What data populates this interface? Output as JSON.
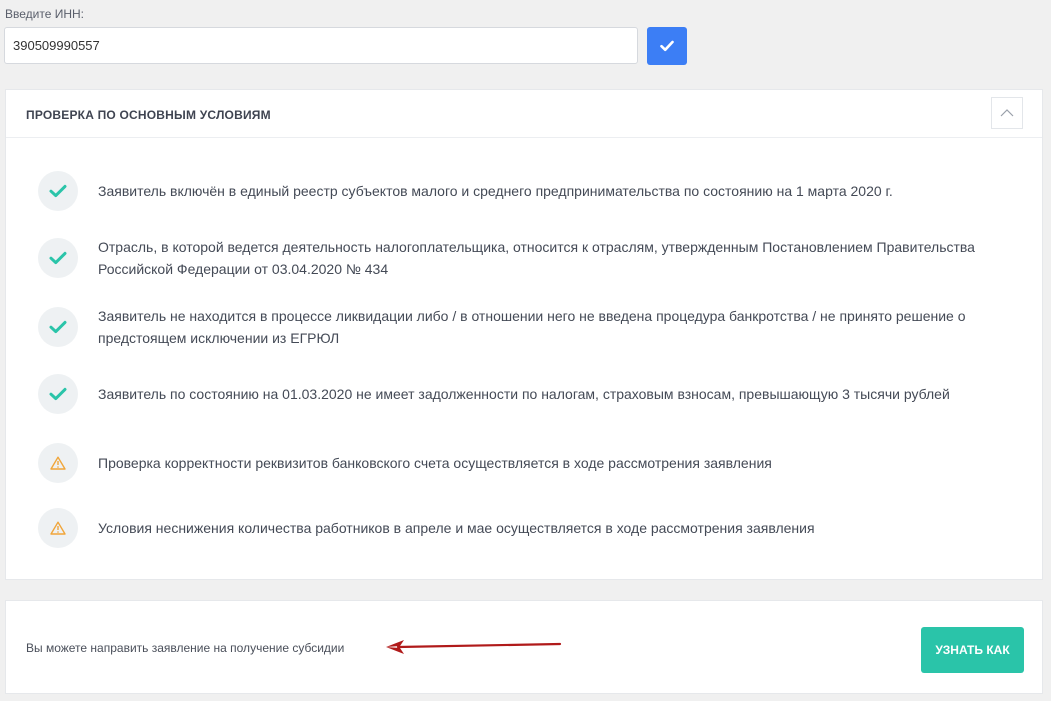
{
  "inn": {
    "label": "Введите ИНН:",
    "value": "390509990557",
    "confirm_icon": "check-icon"
  },
  "check_section": {
    "title": "ПРОВЕРКА ПО ОСНОВНЫМ УСЛОВИЯМ",
    "collapse_icon": "chevron-up-icon",
    "items": [
      {
        "status": "ok",
        "icon": "check-icon",
        "text": "Заявитель включён в единый реестр субъектов малого и среднего предпринимательства по состоянию на 1 марта 2020 г."
      },
      {
        "status": "ok",
        "icon": "check-icon",
        "text": "Отрасль, в которой ведется деятельность налогоплательщика, относится к отраслям, утвержденным Постановлением Правительства Российской Федерации от 03.04.2020 № 434"
      },
      {
        "status": "ok",
        "icon": "check-icon",
        "text": "Заявитель не находится в процессе ликвидации либо / в отношении него не введена процедура банкротства / не принято решение о предстоящем исключении из ЕГРЮЛ"
      },
      {
        "status": "ok",
        "icon": "check-icon",
        "text": "Заявитель по состоянию на 01.03.2020 не имеет задолженности по налогам, страховым взносам, превышающую 3 тысячи рублей"
      },
      {
        "status": "warning",
        "icon": "warning-icon",
        "text": "Проверка корректности реквизитов банковского счета осуществляется в ходе рассмотрения заявления"
      },
      {
        "status": "warning",
        "icon": "warning-icon",
        "text": "Условия неснижения количества работников в апреле и мае осуществляется в ходе рассмотрения заявления"
      }
    ]
  },
  "subsidy": {
    "text": "Вы можете направить заявление на получение субсидии",
    "button_label": "УЗНАТЬ КАК"
  },
  "colors": {
    "confirm_button": "#3c7ef5",
    "check_icon": "#2ac4a9",
    "warning_icon": "#f0a53a",
    "learn_button": "#2ac4a9",
    "arrow": "#b01a1a"
  }
}
